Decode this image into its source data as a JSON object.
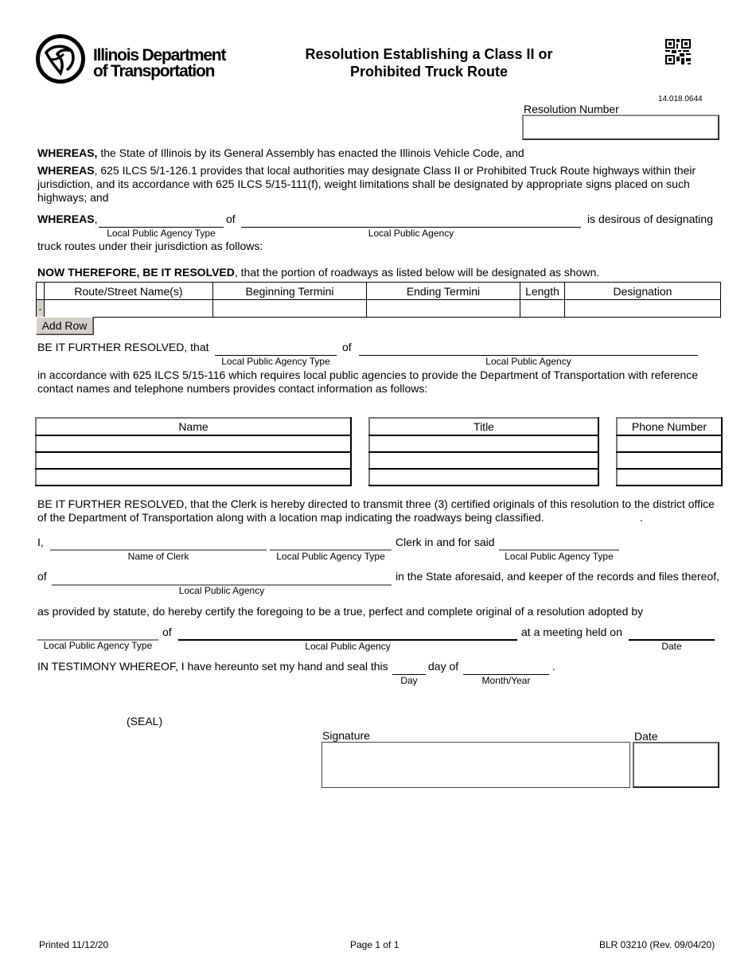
{
  "header": {
    "logo_line1": "Illinois Department",
    "logo_line2": "of Transportation",
    "title_line1": "Resolution Establishing a Class II or",
    "title_line2": "Prohibited Truck Route",
    "form_code": "14.018.0644",
    "resolution_number_label": "Resolution Number",
    "resolution_number_value": ""
  },
  "whereas": {
    "p1_bold": "WHEREAS,",
    "p1_text": " the State of Illinois by its General Assembly has enacted the Illinois Vehicle Code, and",
    "p2_bold": "WHEREAS",
    "p2_text": ", 625 ILCS 5/1-126.1 provides that local authorities may designate Class II or Prohibited Truck Route highways within their jurisdiction, and its accordance with 625 ILCS 5/15-111(f), weight limitations shall be designated by appropriate signs placed on such highways; and",
    "p3_bold": "WHEREAS",
    "p3_comma": ",",
    "p3_of": "of",
    "p3_tail": "is desirous of designating",
    "p3_cap_type": "Local Public Agency Type",
    "p3_cap_agency": "Local Public Agency",
    "p3_cont": "truck routes under their jurisdiction as follows:"
  },
  "resolved": {
    "bold": "NOW THEREFORE, BE IT RESOLVED",
    "text": ", that the portion of roadways as listed below will be designated as shown."
  },
  "route_table": {
    "columns": [
      "Route/Street Name(s)",
      "Beginning Termini",
      "Ending Termini",
      "Length",
      "Designation"
    ],
    "rows": [
      {
        "delete_label": "-",
        "values": [
          "",
          "",
          "",
          "",
          ""
        ]
      }
    ],
    "add_row_label": "Add Row"
  },
  "further1": {
    "lead": "BE IT FURTHER RESOLVED, that",
    "of": "of",
    "cap_type": "Local Public Agency Type",
    "cap_agency": "Local Public Agency",
    "text": "in accordance with 625 ILCS 5/15-116 which requires local public agencies to provide the Department of Transportation with reference contact names and telephone numbers provides contact information as follows:"
  },
  "contacts": {
    "name_header": "Name",
    "title_header": "Title",
    "phone_header": "Phone Number",
    "rows": [
      {
        "name": "",
        "title": "",
        "phone": ""
      },
      {
        "name": "",
        "title": "",
        "phone": ""
      },
      {
        "name": "",
        "title": "",
        "phone": ""
      }
    ]
  },
  "further2": {
    "text": "BE IT FURTHER RESOLVED, that the Clerk is hereby directed to transmit three (3) certified originals of this resolution to the district office of the Department of Transportation along with a location map indicating the roadways being classified.",
    "trailing_dot": "."
  },
  "certification": {
    "i_label": "I,",
    "cap_clerk": "Name of Clerk",
    "cap_type1": "Local Public Agency Type",
    "clerk_text": "Clerk in and for said",
    "cap_type2": "Local Public Agency Type",
    "of_label": "of",
    "state_text": "in the State aforesaid, and keeper of the records and files thereof,",
    "cap_agency": "Local Public Agency",
    "statute_text": "as provided by statute, do hereby certify the foregoing to be a true, perfect and complete original of a resolution adopted by",
    "of2_label": "of",
    "meeting_text": "at a meeting held on",
    "cap_type3": "Local Public Agency Type",
    "cap_agency2": "Local Public Agency",
    "cap_date": "Date",
    "testimony_text": "IN TESTIMONY WHEREOF, I have hereunto set my hand and seal this",
    "day_of": "day of",
    "period": ".",
    "cap_day": "Day",
    "cap_month_year": "Month/Year"
  },
  "signature": {
    "seal": "(SEAL)",
    "signature_label": "Signature",
    "date_label": "Date"
  },
  "footer": {
    "printed": "Printed 11/12/20",
    "page": "Page 1 of 1",
    "form_id": "BLR 03210 (Rev. 09/04/20)"
  }
}
